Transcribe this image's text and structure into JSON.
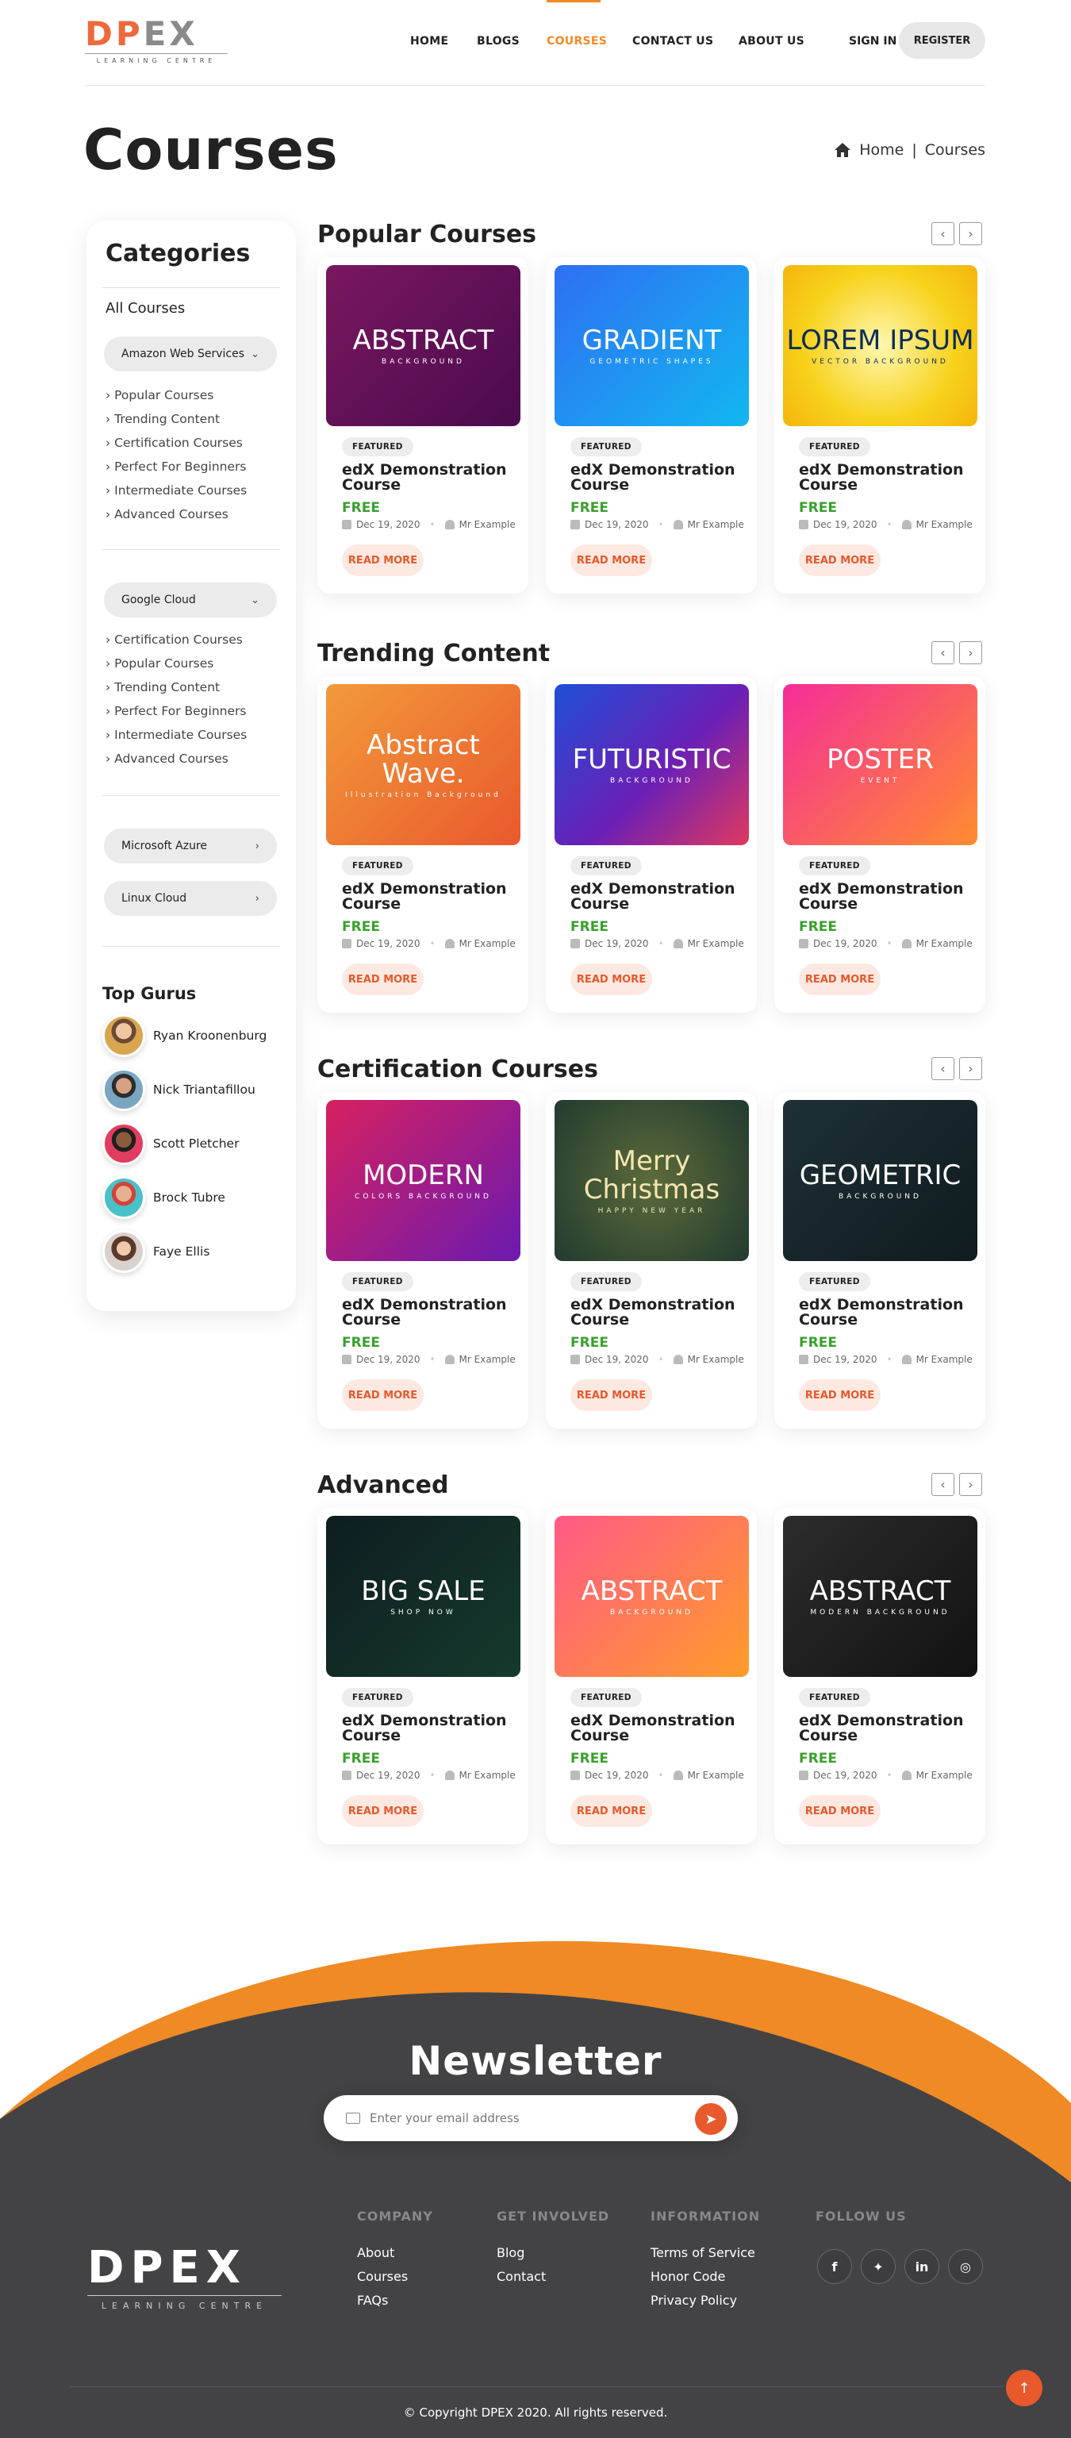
{
  "header": {
    "logo_main_a": "DP",
    "logo_main_b": "E",
    "logo_main_c": "X",
    "logo_sub": "LEARNING CENTRE",
    "nav": [
      "HOME",
      "BLOGS",
      "COURSES",
      "CONTACT US",
      "ABOUT US"
    ],
    "active_nav": "COURSES",
    "sign_in": "SIGN IN",
    "register": "REGISTER"
  },
  "page": {
    "title": "Courses",
    "breadcrumb": {
      "home": "Home",
      "sep": "|",
      "current": "Courses"
    }
  },
  "sidebar": {
    "title": "Categories",
    "all_courses": "All Courses",
    "groups": [
      {
        "label": "Amazon Web Services",
        "items": [
          "Popular Courses",
          "Trending Content",
          "Certification Courses",
          "Perfect For Beginners",
          "Intermediate Courses",
          "Advanced Courses"
        ]
      },
      {
        "label": "Google Cloud",
        "items": [
          "Certification Courses",
          "Popular Courses",
          "Trending Content",
          "Perfect For Beginners",
          "Intermediate Courses",
          "Advanced Courses"
        ]
      },
      {
        "label": "Microsoft Azure"
      },
      {
        "label": "Linux Cloud"
      }
    ],
    "gurus_title": "Top Gurus",
    "gurus": [
      "Ryan Kroonenburg",
      "Nick Triantafillou",
      "Scott Pletcher",
      "Brock Tubre",
      "Faye Ellis"
    ]
  },
  "sections": [
    {
      "title": "Popular Courses",
      "thumbs": [
        {
          "t1": "ABSTRACT",
          "t2": "BACKGROUND"
        },
        {
          "t1": "GRADIENT",
          "t2": "GEOMETRIC SHAPES"
        },
        {
          "t1": "LOREM IPSUM",
          "t2": "VECTOR BACKGROUND"
        }
      ]
    },
    {
      "title": "Trending Content",
      "thumbs": [
        {
          "t1": "Abstract Wave.",
          "t2": "Illustration Background"
        },
        {
          "t1": "FUTURISTIC",
          "t2": "BACKGROUND"
        },
        {
          "t1": "POSTER",
          "t2": "EVENT"
        }
      ]
    },
    {
      "title": "Certification Courses",
      "thumbs": [
        {
          "t1": "MODERN",
          "t2": "COLORS BACKGROUND"
        },
        {
          "t1": "Merry Christmas",
          "t2": "HAPPY NEW YEAR"
        },
        {
          "t1": "GEOMETRIC",
          "t2": "BACKGROUND"
        }
      ]
    },
    {
      "title": "Advanced",
      "thumbs": [
        {
          "t1": "BIG SALE",
          "t2": "SHOP NOW"
        },
        {
          "t1": "ABSTRACT",
          "t2": "BACKGROUND"
        },
        {
          "t1": "ABSTRACT",
          "t2": "MODERN BACKGROUND"
        }
      ]
    }
  ],
  "card": {
    "badge": "FEATURED",
    "title": "edX Demonstration Course",
    "price": "FREE",
    "date": "Dec 19, 2020",
    "author": "Mr Example",
    "read_more": "READ MORE"
  },
  "footer": {
    "newsletter_title": "Newsletter",
    "email_placeholder": "Enter your email address",
    "logo_main": "DPEX",
    "logo_sub": "LEARNING CENTRE",
    "columns": [
      {
        "heading": "COMPANY",
        "links": [
          "About",
          "Courses",
          "FAQs"
        ]
      },
      {
        "heading": "GET INVOLVED",
        "links": [
          "Blog",
          "Contact"
        ]
      },
      {
        "heading": "INFORMATION",
        "links": [
          "Terms of Service",
          "Honor Code",
          "Privacy Policy"
        ]
      },
      {
        "heading": "FOLLOW US",
        "links": []
      }
    ],
    "social": [
      "facebook-icon",
      "twitter-icon",
      "linkedin-icon",
      "instagram-icon"
    ],
    "copyright": "© Copyright DPEX 2020. All rights reserved."
  },
  "colors": {
    "accent": "#f08a24",
    "cta": "#e8592b",
    "footer_bg": "#434345",
    "price": "#3aa02e"
  }
}
